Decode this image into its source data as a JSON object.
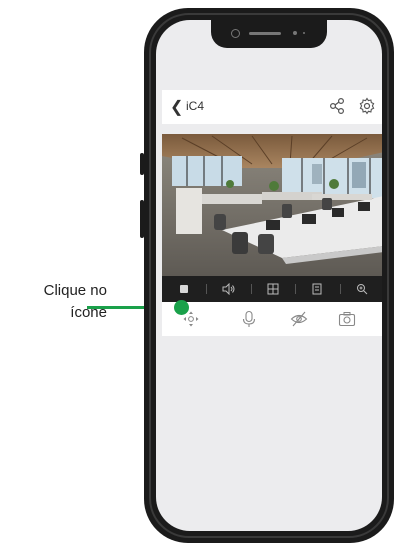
{
  "annotation": {
    "text_line1": "Clique no",
    "text_line2": "ícone"
  },
  "app": {
    "title": "iC4",
    "accent": "#1aa14a"
  },
  "toolbar_icons": [
    "stop-icon",
    "volume-icon",
    "split-view-icon",
    "storage-icon",
    "zoom-icon"
  ],
  "control_icons": [
    "ptz-move-icon",
    "microphone-icon",
    "privacy-eye-off-icon",
    "camera-snapshot-icon"
  ]
}
